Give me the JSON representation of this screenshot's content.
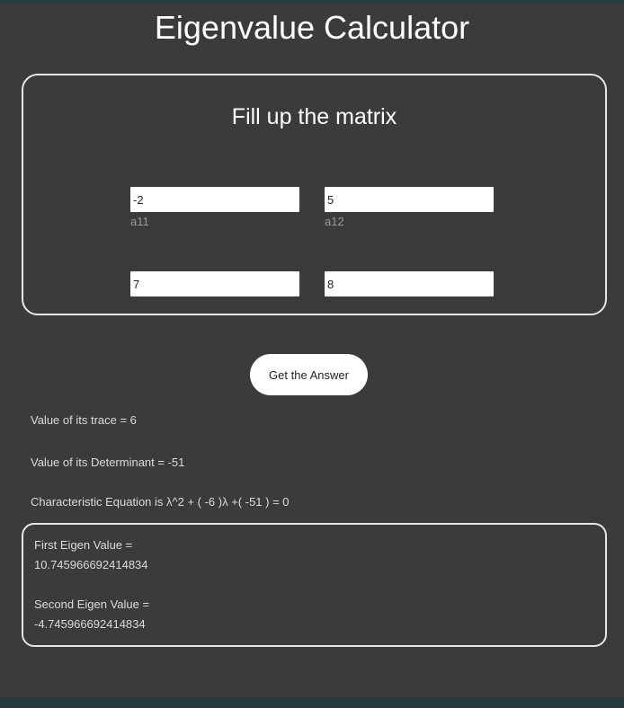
{
  "app": {
    "title": "Eigenvalue Calculator"
  },
  "matrix": {
    "heading": "Fill up the matrix",
    "a11": {
      "value": "-2",
      "label": "a11"
    },
    "a12": {
      "value": "5",
      "label": "a12"
    },
    "a21": {
      "value": "7"
    },
    "a22": {
      "value": "8"
    }
  },
  "actions": {
    "answer_label": "Get the Answer"
  },
  "results": {
    "trace": "Value of its trace = 6",
    "determinant": "Value of its Determinant = -51",
    "equation": "Characteristic Equation is λ^2 + ( -6 )λ +( -51 ) = 0"
  },
  "eigen": {
    "first_label": "First Eigen Value =",
    "first_value": "10.745966692414834",
    "second_label": "Second Eigen Value =",
    "second_value": "-4.745966692414834"
  },
  "colors": {
    "background": "#3c3a3a",
    "frame": "#263a40",
    "card_border": "#e6e6e6",
    "text": "#ffffff",
    "muted_text": "#9a9a9a"
  }
}
